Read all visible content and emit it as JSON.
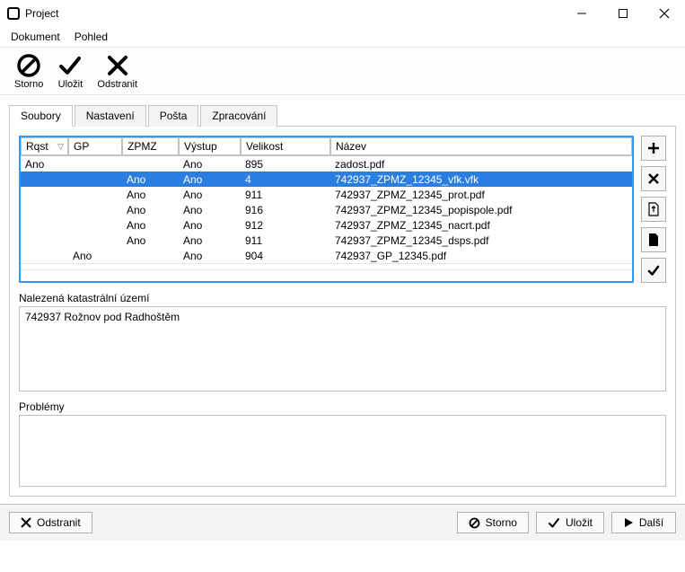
{
  "window": {
    "title": "Project"
  },
  "menu": {
    "document": "Dokument",
    "view": "Pohled"
  },
  "toolbar": {
    "storno": "Storno",
    "ulozit": "Uložit",
    "odstranit": "Odstranit"
  },
  "tabs": {
    "soubory": "Soubory",
    "nastaveni": "Nastavení",
    "posta": "Pošta",
    "zpracovani": "Zpracování"
  },
  "grid": {
    "headers": {
      "rqst": "Rqst",
      "gp": "GP",
      "zpmz": "ZPMZ",
      "vystup": "Výstup",
      "velikost": "Velikost",
      "nazev": "Název"
    },
    "rows": [
      {
        "rqst": "Ano",
        "gp": "",
        "zpmz": "",
        "vystup": "Ano",
        "velikost": "895",
        "nazev": "zadost.pdf",
        "sel": false
      },
      {
        "rqst": "",
        "gp": "",
        "zpmz": "Ano",
        "vystup": "Ano",
        "velikost": "4",
        "nazev": "742937_ZPMZ_12345_vfk.vfk",
        "sel": true
      },
      {
        "rqst": "",
        "gp": "",
        "zpmz": "Ano",
        "vystup": "Ano",
        "velikost": "911",
        "nazev": "742937_ZPMZ_12345_prot.pdf",
        "sel": false
      },
      {
        "rqst": "",
        "gp": "",
        "zpmz": "Ano",
        "vystup": "Ano",
        "velikost": "916",
        "nazev": "742937_ZPMZ_12345_popispole.pdf",
        "sel": false
      },
      {
        "rqst": "",
        "gp": "",
        "zpmz": "Ano",
        "vystup": "Ano",
        "velikost": "912",
        "nazev": "742937_ZPMZ_12345_nacrt.pdf",
        "sel": false
      },
      {
        "rqst": "",
        "gp": "",
        "zpmz": "Ano",
        "vystup": "Ano",
        "velikost": "911",
        "nazev": "742937_ZPMZ_12345_dsps.pdf",
        "sel": false
      },
      {
        "rqst": "",
        "gp": "Ano",
        "zpmz": "",
        "vystup": "Ano",
        "velikost": "904",
        "nazev": "742937_GP_12345.pdf",
        "sel": false
      }
    ]
  },
  "sections": {
    "found_label": "Nalezená katastrální území",
    "found_value": "742937 Rožnov pod Radhoštěm",
    "problems_label": "Problémy",
    "problems_value": ""
  },
  "footer": {
    "odstranit": "Odstranit",
    "storno": "Storno",
    "ulozit": "Uložit",
    "dalsi": "Další"
  }
}
